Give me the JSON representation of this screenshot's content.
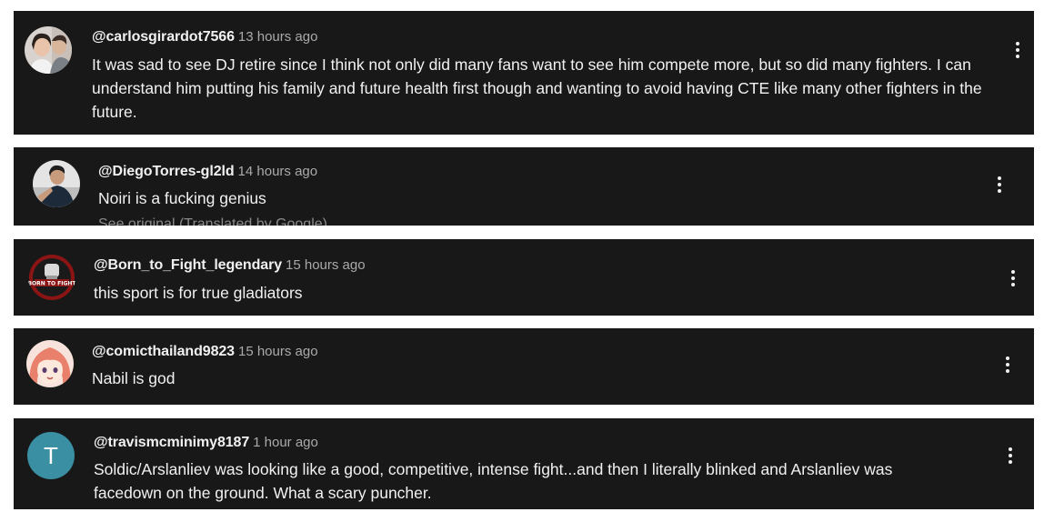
{
  "comments": [
    {
      "handle": "@carlosgirardot7566",
      "time": "13 hours ago",
      "text": "It was sad to see DJ retire since I think not only did many fans want to see him compete more, but so did many fighters. I can understand him putting his family and future health first though and wanting to avoid having CTE like many other fighters in the future.",
      "avatar_icon": "couple-photo-icon"
    },
    {
      "handle": "@DiegoTorres-gl2ld",
      "time": "14 hours ago",
      "text": "Noiri is a fucking genius",
      "subtext": "See original (Translated by Google)",
      "avatar_icon": "person-photo-icon"
    },
    {
      "handle": "@Born_to_Fight_legendary",
      "time": "15 hours ago",
      "text": "this sport is for true gladiators",
      "avatar_icon": "born-to-fight-logo-icon"
    },
    {
      "handle": "@comicthailand9823",
      "time": "15 hours ago",
      "text": "Nabil is god",
      "avatar_icon": "anime-girl-icon"
    },
    {
      "handle": "@travismcminimy8187",
      "time": "1 hour ago",
      "text": "Soldic/Arslanliev was looking like a good, competitive, intense fight...and then I literally blinked and Arslanliev was facedown on the ground. What a scary puncher.",
      "avatar_letter": "T",
      "avatar_color": "#3a8fa3"
    }
  ],
  "colors": {
    "card_background": "#181818",
    "text_primary": "#f1f1f1",
    "text_secondary": "#aaaaaa",
    "page_background": "#ffffff"
  }
}
